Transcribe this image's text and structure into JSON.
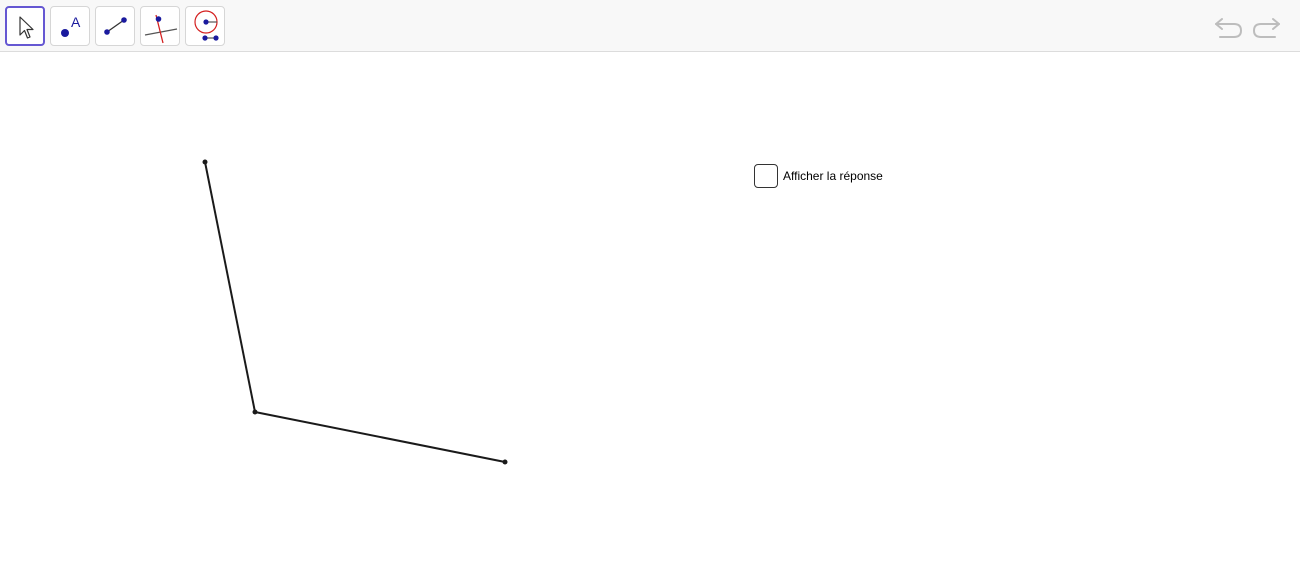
{
  "toolbar": {
    "tools": [
      {
        "name": "move-tool",
        "icon": "arrow-pointer-icon",
        "selected": true
      },
      {
        "name": "point-tool",
        "icon": "point-a-icon",
        "label": "A",
        "selected": false
      },
      {
        "name": "segment-tool",
        "icon": "segment-icon",
        "selected": false
      },
      {
        "name": "perpendicular-line-tool",
        "icon": "perpendicular-line-icon",
        "selected": false
      },
      {
        "name": "circle-center-radius-tool",
        "icon": "circle-radius-icon",
        "selected": false
      }
    ],
    "undo_icon": "undo-icon",
    "redo_icon": "redo-icon"
  },
  "colors": {
    "selected_border": "#6557d2",
    "point_blue": "#1a1a9e",
    "red": "#d42020",
    "disabled_gray": "#bdbdbd"
  },
  "checkbox": {
    "label": "Afficher la réponse",
    "checked": false
  }
}
